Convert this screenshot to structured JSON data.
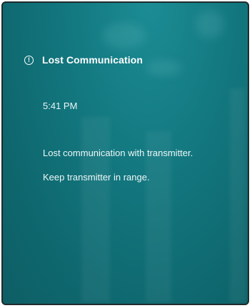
{
  "alert": {
    "icon": "alert-circle-icon",
    "title": "Lost Communication",
    "time": "5:41 PM",
    "message_line1": "Lost communication with transmitter.",
    "message_line2": "Keep transmitter in range."
  },
  "colors": {
    "background": "#137580",
    "text": "#ffffff"
  }
}
